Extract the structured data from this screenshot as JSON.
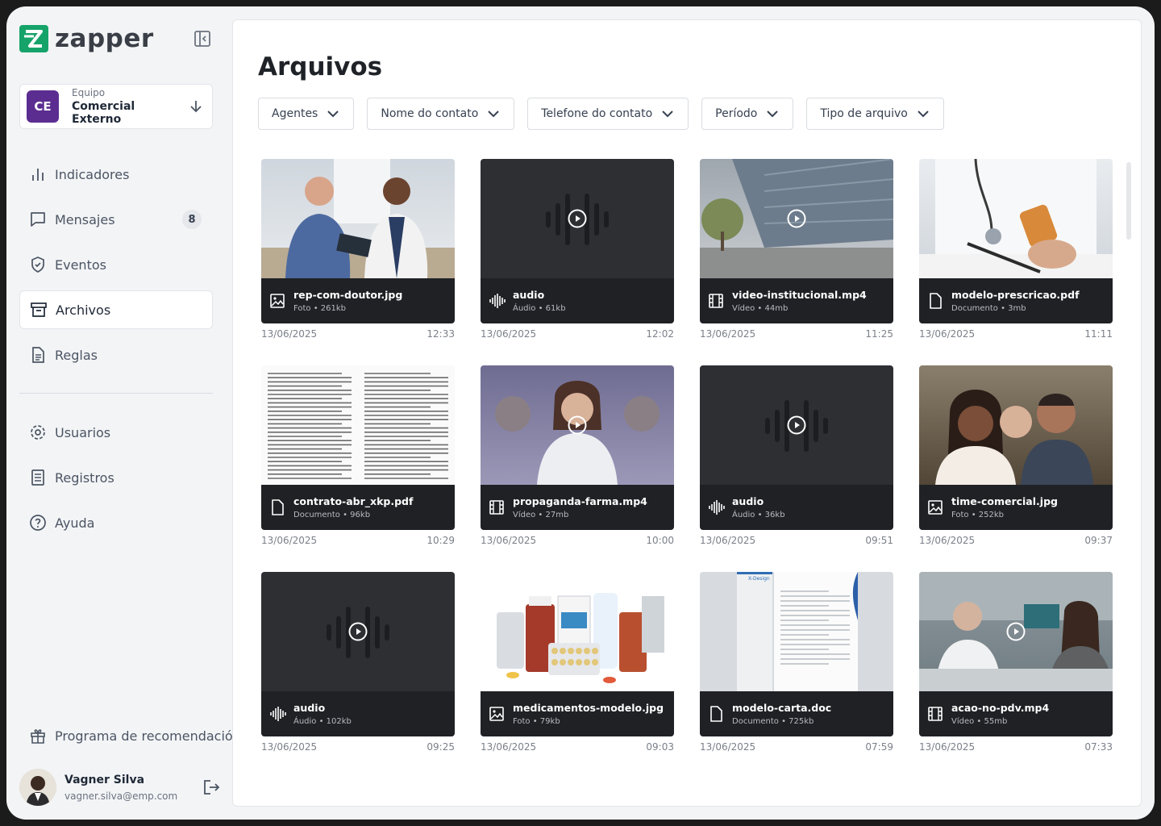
{
  "app": {
    "logo_text": "zapper",
    "brand_color": "#16a36a"
  },
  "team": {
    "initials": "CE",
    "label": "Equipo",
    "name": "Comercial Externo",
    "color": "#5c2d91"
  },
  "nav": [
    {
      "label": "Indicadores",
      "icon": "bar-chart-icon"
    },
    {
      "label": "Mensajes",
      "icon": "message-icon",
      "badge": "8"
    },
    {
      "label": "Eventos",
      "icon": "shield-icon"
    },
    {
      "label": "Archivos",
      "icon": "archive-icon",
      "active": true
    },
    {
      "label": "Reglas",
      "icon": "document-icon"
    },
    {
      "label": "Usuarios",
      "icon": "gear-icon"
    },
    {
      "label": "Registros",
      "icon": "list-icon"
    },
    {
      "label": "Ayuda",
      "icon": "help-icon"
    }
  ],
  "referral": {
    "label": "Programa de recomendación",
    "icon": "gift-icon"
  },
  "user": {
    "name": "Vagner Silva",
    "email": "vagner.silva@emp.com"
  },
  "page": {
    "title": "Arquivos"
  },
  "filters": [
    "Agentes",
    "Nome do contato",
    "Telefone do contato",
    "Período",
    "Tipo de arquivo"
  ],
  "files": [
    {
      "name": "rep-com-doutor.jpg",
      "meta": "Foto • 261kb",
      "date": "13/06/2025",
      "time": "12:33",
      "kind": "photo"
    },
    {
      "name": "audio",
      "meta": "Áudio • 61kb",
      "date": "13/06/2025",
      "time": "12:02",
      "kind": "audio"
    },
    {
      "name": "video-institucional.mp4",
      "meta": "Vídeo • 44mb",
      "date": "13/06/2025",
      "time": "11:25",
      "kind": "video"
    },
    {
      "name": "modelo-prescricao.pdf",
      "meta": "Documento • 3mb",
      "date": "13/06/2025",
      "time": "11:11",
      "kind": "document"
    },
    {
      "name": "contrato-abr_xkp.pdf",
      "meta": "Documento • 96kb",
      "date": "13/06/2025",
      "time": "10:29",
      "kind": "document"
    },
    {
      "name": "propaganda-farma.mp4",
      "meta": "Vídeo • 27mb",
      "date": "13/06/2025",
      "time": "10:00",
      "kind": "video"
    },
    {
      "name": "audio",
      "meta": "Áudio • 36kb",
      "date": "13/06/2025",
      "time": "09:51",
      "kind": "audio"
    },
    {
      "name": "time-comercial.jpg",
      "meta": "Foto • 252kb",
      "date": "13/06/2025",
      "time": "09:37",
      "kind": "photo"
    },
    {
      "name": "audio",
      "meta": "Áudio • 102kb",
      "date": "13/06/2025",
      "time": "09:25",
      "kind": "audio"
    },
    {
      "name": "medicamentos-modelo.jpg",
      "meta": "Foto • 79kb",
      "date": "13/06/2025",
      "time": "09:03",
      "kind": "photo"
    },
    {
      "name": "modelo-carta.doc",
      "meta": "Documento • 725kb",
      "date": "13/06/2025",
      "time": "07:59",
      "kind": "document"
    },
    {
      "name": "acao-no-pdv.mp4",
      "meta": "Vídeo • 55mb",
      "date": "13/06/2025",
      "time": "07:33",
      "kind": "video"
    }
  ]
}
